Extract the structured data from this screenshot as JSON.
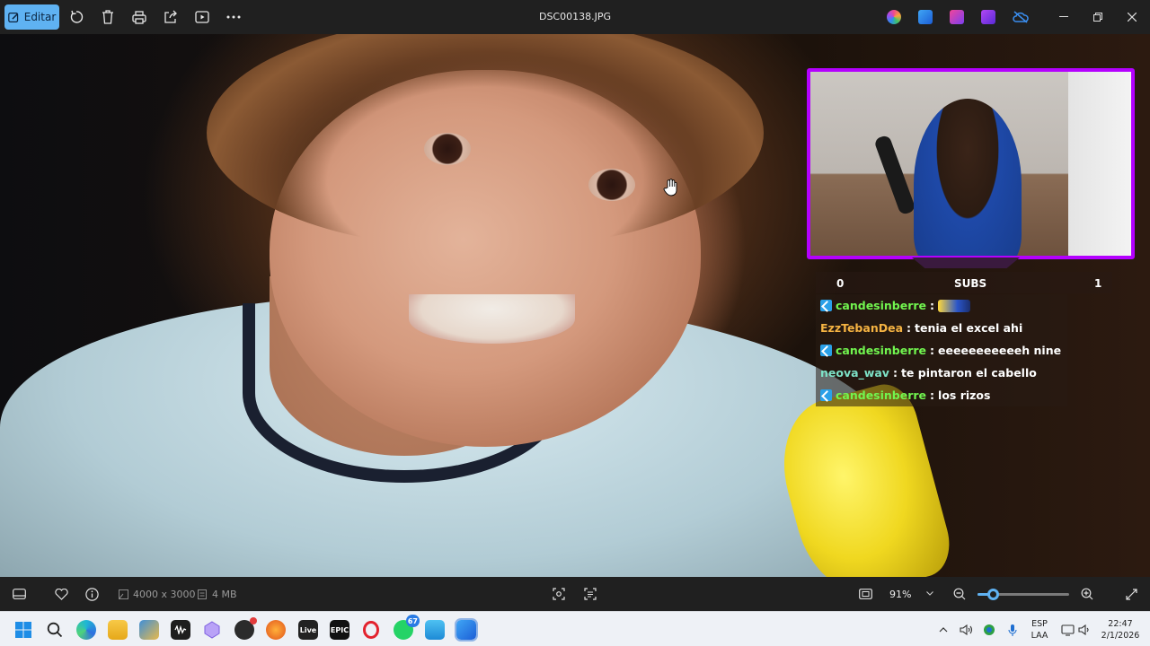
{
  "toolbar": {
    "edit_label": "Editar",
    "file_name": "DSC00138.JPG"
  },
  "overlay": {
    "subs_left": "0",
    "subs_label": "SUBS",
    "subs_right": "1",
    "frame_color": "#b400ff"
  },
  "chat": [
    {
      "user": "candesinberre",
      "sep": " :",
      "message": "",
      "emote": true,
      "color": "green"
    },
    {
      "user": "EzzTebanDea",
      "sep": " :",
      "message": "tenia el excel ahi",
      "emote": false,
      "color": "orange"
    },
    {
      "user": "candesinberre",
      "sep": " :",
      "message": "eeeeeeeeeeeh nine",
      "emote": false,
      "color": "green"
    },
    {
      "user": "neova_wav",
      "sep": " :",
      "message": "te pintaron el cabello",
      "emote": false,
      "color": "teal"
    },
    {
      "user": "candesinberre",
      "sep": " :",
      "message": "los rizos",
      "emote": false,
      "color": "green"
    }
  ],
  "bottombar": {
    "dimensions": "4000 x 3000",
    "file_size": "4 MB",
    "zoom": "91%",
    "zoom_level": 0.17
  },
  "taskbar": {
    "whatsapp_badge": "67",
    "language": "ESP",
    "layout": "LAA",
    "time": "22:47",
    "date": "2/1/2026"
  },
  "colors": {
    "accent": "#5fb2f2",
    "chat_green": "#71f54f",
    "chat_orange": "#f5b342",
    "chat_teal": "#7de2c7"
  }
}
